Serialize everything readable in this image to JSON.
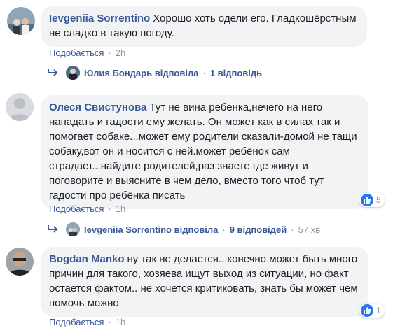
{
  "comments": [
    {
      "author": "Ievgeniia Sorrentino",
      "text": "Хорошо хоть одели его. Гладкошёрстным не сладко в такую погоду.",
      "action": "Подобається",
      "time": "2h",
      "reply": {
        "name": "Юлия Бондарь",
        "verb": "відповіла",
        "count": "1 відповідь"
      }
    },
    {
      "author": "Олеся Свистунова",
      "text": "Тут не вина ребенка,нечего на него нападать и гадости ему желать. Он может как в силах так и помогает собаке...может ему родители сказали-домой не тащи собаку,вот он и носится с ней.может ребёнок сам страдает...найдите родителей,раз знаете где живут и поговорите и выясните в чем дело, вместо того чтоб тут гадости про ребёнка писать",
      "action": "Подобається",
      "time": "1h",
      "reactions": "5",
      "reply": {
        "name": "Ievgeniia Sorrentino",
        "verb": "відповіла",
        "count": "9 відповідей",
        "time": "57 хв"
      }
    },
    {
      "author": "Bogdan Manko",
      "text": "ну так не делается.. конечно может быть много причин для такого, хозяева ищут выход из ситуации, но факт остается фактом.. не хочется критиковать, знать бы может чем помочь можно",
      "action": "Подобається",
      "time": "1h",
      "reactions": "1"
    }
  ],
  "colors": {
    "link": "#385898",
    "bubble": "#f2f3f5",
    "meta": "#90949c",
    "like": "#2078f4"
  }
}
